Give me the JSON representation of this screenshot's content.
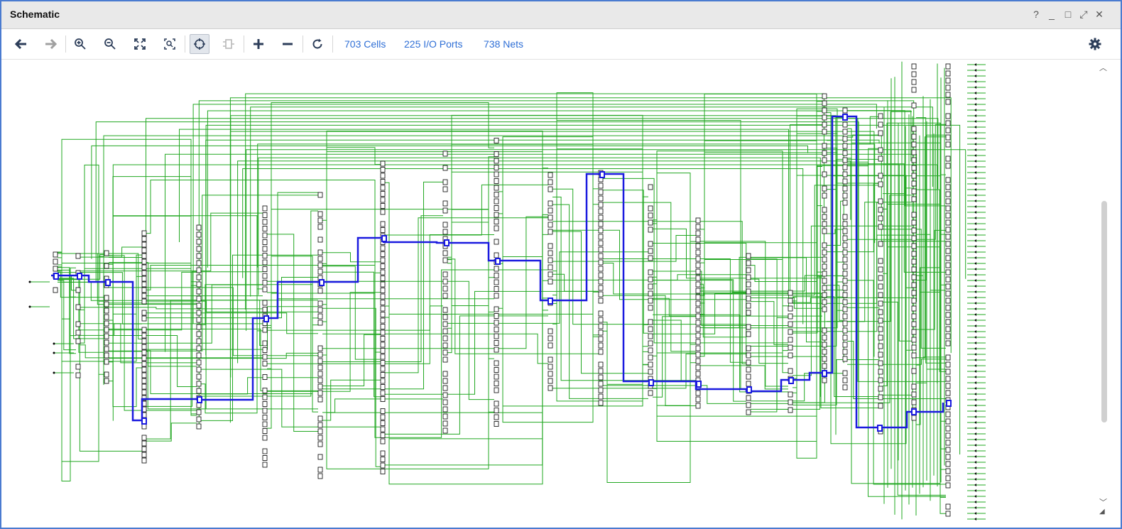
{
  "window": {
    "title": "Schematic",
    "controls": {
      "help": "?",
      "minimize": "_",
      "maximize": "□",
      "float": "⤢",
      "close": "✕"
    }
  },
  "toolbar": {
    "buttons": [
      {
        "name": "back-button",
        "icon": "arrow-left-icon"
      },
      {
        "name": "forward-button",
        "icon": "arrow-right-icon"
      },
      {
        "name": "zoom-in-button",
        "icon": "zoom-in-icon"
      },
      {
        "name": "zoom-out-button",
        "icon": "zoom-out-icon"
      },
      {
        "name": "zoom-fit-button",
        "icon": "fit-icon"
      },
      {
        "name": "zoom-area-button",
        "icon": "zoom-area-icon"
      },
      {
        "name": "select-mode-button",
        "icon": "crosshair-icon",
        "active": true
      },
      {
        "name": "cell-button",
        "icon": "cell-icon",
        "disabled": true
      },
      {
        "name": "expand-button",
        "icon": "plus-icon"
      },
      {
        "name": "collapse-button",
        "icon": "minus-icon"
      },
      {
        "name": "refresh-button",
        "icon": "refresh-icon"
      }
    ],
    "stats": {
      "cells": "703 Cells",
      "io_ports": "225 I/O Ports",
      "nets": "738 Nets"
    },
    "settings_icon": "gear-icon"
  },
  "colors": {
    "net": "#22a822",
    "highlight": "#1a1adf",
    "accent_text": "#2f6fd6",
    "border": "#4a7bd0"
  }
}
